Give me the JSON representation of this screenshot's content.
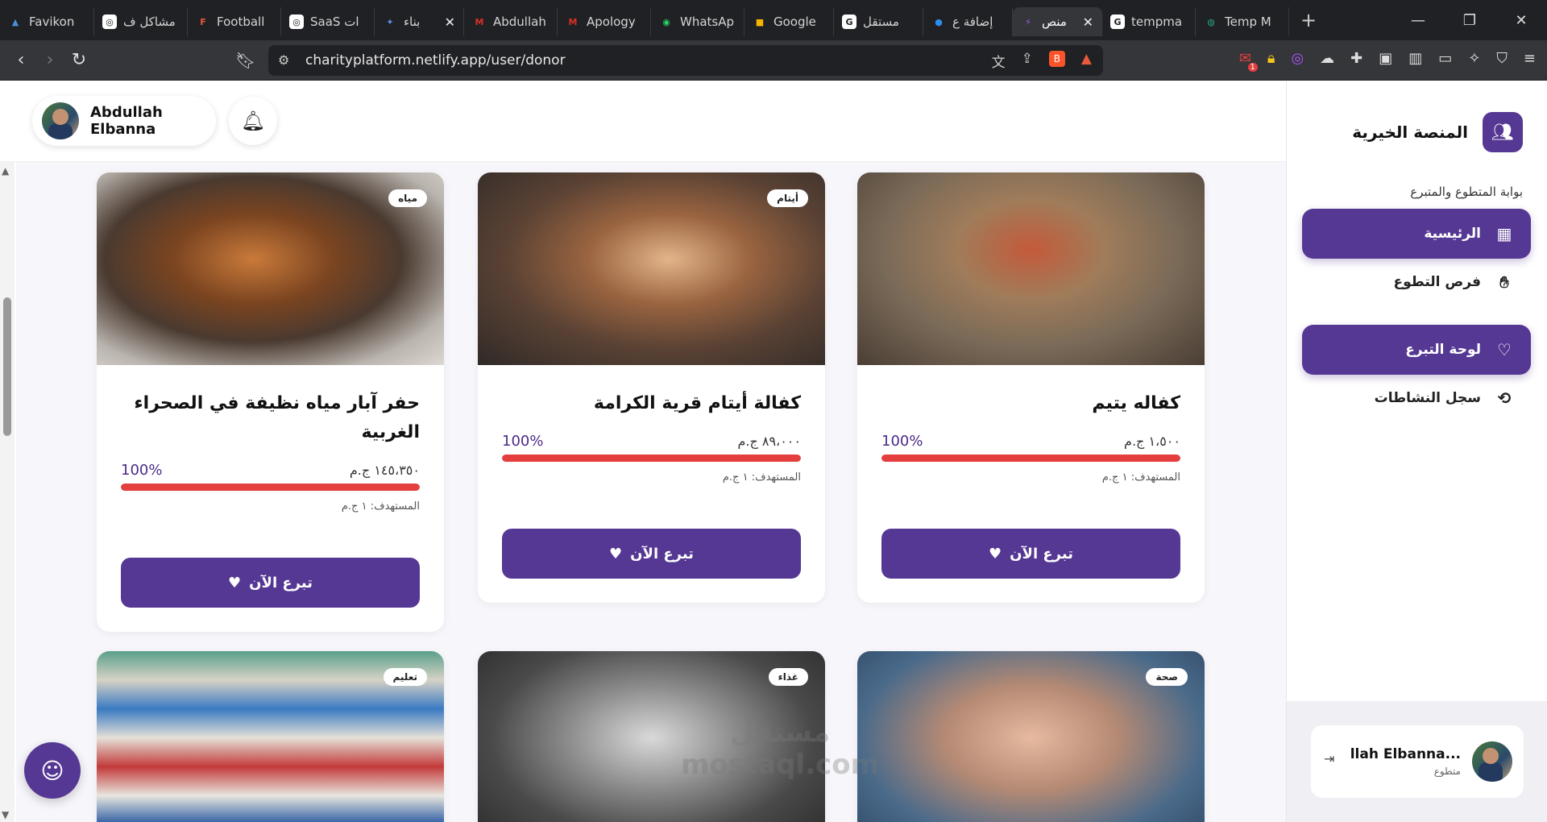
{
  "browser": {
    "tabs": [
      {
        "title": "Favikon",
        "color": "#4a90d9",
        "glyph": "▲"
      },
      {
        "title": "مشاكل ف",
        "color": "#ffffff",
        "glyph": "◎"
      },
      {
        "title": "Football",
        "color": "#e8583a",
        "glyph": "F"
      },
      {
        "title": "SaaS ات",
        "color": "#ffffff",
        "glyph": "◎"
      },
      {
        "title": "بناء",
        "color": "#5b8def",
        "glyph": "✦",
        "active": true
      },
      {
        "title": "Abdullah",
        "color": "#d93025",
        "glyph": "M"
      },
      {
        "title": "Apology",
        "color": "#d93025",
        "glyph": "M"
      },
      {
        "title": "WhatsAp",
        "color": "#25d366",
        "glyph": "◉"
      },
      {
        "title": "Google",
        "color": "#f7b500",
        "glyph": "■"
      },
      {
        "title": "مستقل",
        "color": "#ffffff",
        "glyph": "G"
      },
      {
        "title": "إضافة ع",
        "color": "#2d8cf0",
        "glyph": "●"
      },
      {
        "title": "منص",
        "color": "#9c5cf5",
        "glyph": "⚡",
        "current": true
      },
      {
        "title": "tempma",
        "color": "#ffffff",
        "glyph": "G"
      },
      {
        "title": "Temp M",
        "color": "#2aa58a",
        "glyph": "◍"
      }
    ],
    "url": "charityplatform.netlify.app/user/donor",
    "notification_count": "1"
  },
  "topbar": {
    "user_name": "Abdullah Elbanna"
  },
  "cards": [
    {
      "tag": "مياه",
      "title": "حفر آبار مياه نظيفة في الصحراء الغربية",
      "amount": "١٤٥،٣٥٠ ج.م",
      "percent": "100%",
      "progress": 100,
      "target": "المستهدف: ١ ج.م",
      "button": "تبرع الآن",
      "img": "img-water"
    },
    {
      "tag": "أيتام",
      "title": "كفالة أيتام قرية الكرامة",
      "amount": "٨٩،٠٠٠ ج.م",
      "percent": "100%",
      "progress": 100,
      "target": "المستهدف: ١ ج.م",
      "button": "تبرع الآن",
      "img": "img-orphans"
    },
    {
      "tag": "",
      "title": "كفاله يتيم",
      "amount": "١،٥٠٠ ج.م",
      "percent": "100%",
      "progress": 100,
      "target": "المستهدف: ١ ج.م",
      "button": "تبرع الآن",
      "img": "img-orphan1"
    },
    {
      "tag": "تعليم",
      "img": "img-books"
    },
    {
      "tag": "غذاء",
      "img": "img-bw"
    },
    {
      "tag": "صحة",
      "img": "img-health"
    }
  ],
  "sidebar": {
    "brand": "المنصة الخيرية",
    "portal_label": "بوابة المتطوع والمتبرع",
    "items": [
      {
        "label": "الرئيسية",
        "active": true
      },
      {
        "label": "فرص التطوع",
        "active": false
      },
      {
        "label": "لوحة التبرع",
        "active": true
      },
      {
        "label": "سجل النشاطات",
        "active": false
      }
    ],
    "profile_name": "...llah Elbanna",
    "profile_role": "متطوع"
  },
  "watermark": {
    "line1": "مستقل",
    "line2": "mostaql.com"
  },
  "colors": {
    "primary": "#553893",
    "progress": "#e53e3e"
  }
}
